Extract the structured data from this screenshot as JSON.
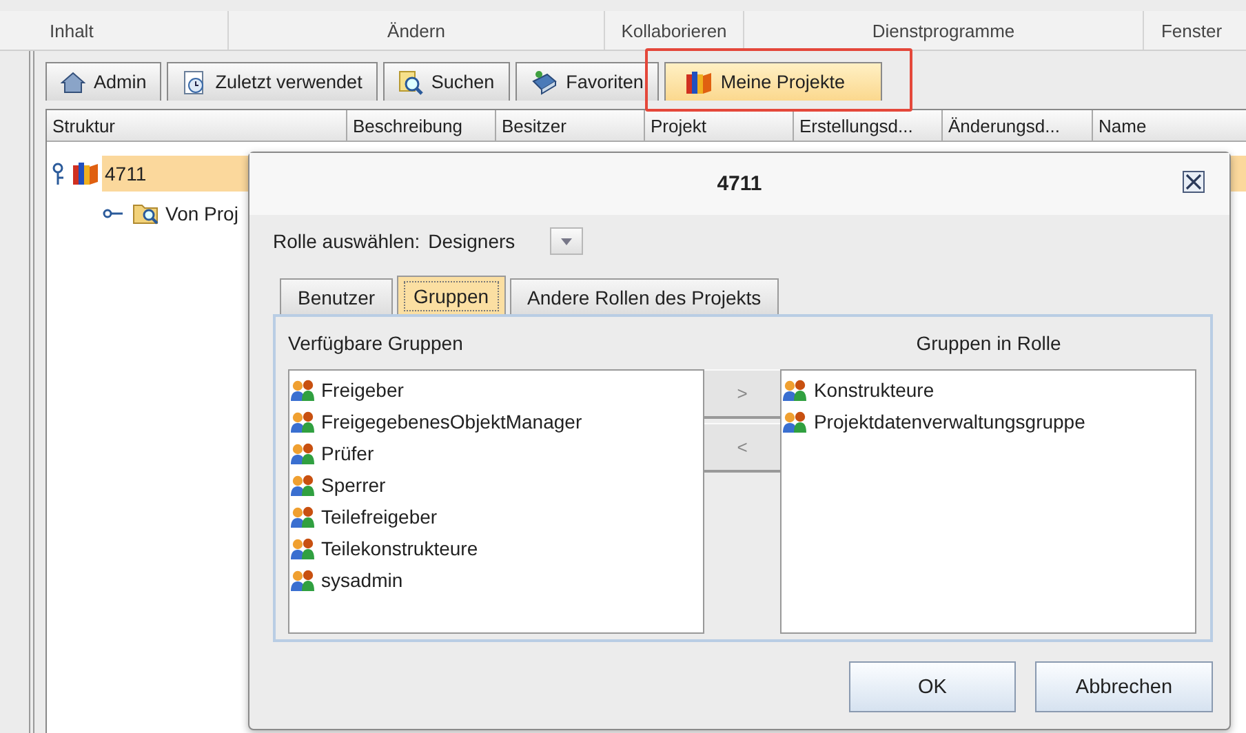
{
  "menu": [
    {
      "label": "Inhalt",
      "disabled": false
    },
    {
      "label": "Ändern",
      "disabled": false
    },
    {
      "label": "Kollaborieren",
      "disabled": false
    },
    {
      "label": "Dienstprogramme",
      "disabled": false
    },
    {
      "label": "Fenster",
      "disabled": false
    }
  ],
  "tabs": [
    {
      "label": "Admin",
      "selected": false,
      "highlighted": false
    },
    {
      "label": "Zuletzt verwendet",
      "selected": false,
      "highlighted": false
    },
    {
      "label": "Suchen",
      "selected": false,
      "highlighted": false
    },
    {
      "label": "Favoriten",
      "selected": false,
      "highlighted": false
    },
    {
      "label": "Meine Projekte",
      "selected": true,
      "highlighted": true
    }
  ],
  "table": {
    "columns": [
      "Struktur",
      "Beschreibung",
      "Besitzer",
      "Projekt",
      "Erstellungsd...",
      "Änderungsd...",
      "Name"
    ]
  },
  "tree": [
    {
      "label": "4711",
      "selected": true,
      "expanded": true,
      "children": [
        {
          "label": "Von Proj",
          "selected": false
        }
      ]
    }
  ],
  "dialog": {
    "title": "4711",
    "role_label": "Rolle auswählen:",
    "role_value": "Designers",
    "tabs": [
      {
        "label": "Benutzer",
        "selected": false
      },
      {
        "label": "Gruppen",
        "selected": true
      },
      {
        "label": "Andere Rollen des Projekts",
        "selected": false
      }
    ],
    "available": {
      "heading": "Verfügbare Gruppen",
      "items": [
        "Freigeber",
        "FreigegebenesObjektManager",
        "Prüfer",
        "Sperrer",
        "Teilefreigeber",
        "Teilekonstrukteure",
        "sysadmin"
      ]
    },
    "assigned": {
      "heading": "Gruppen in Rolle",
      "items": [
        "Konstrukteure",
        "Projektdatenverwaltungsgruppe"
      ]
    },
    "move_buttons": [
      ">",
      "<"
    ],
    "buttons": [
      "OK",
      "Abbrechen"
    ]
  }
}
